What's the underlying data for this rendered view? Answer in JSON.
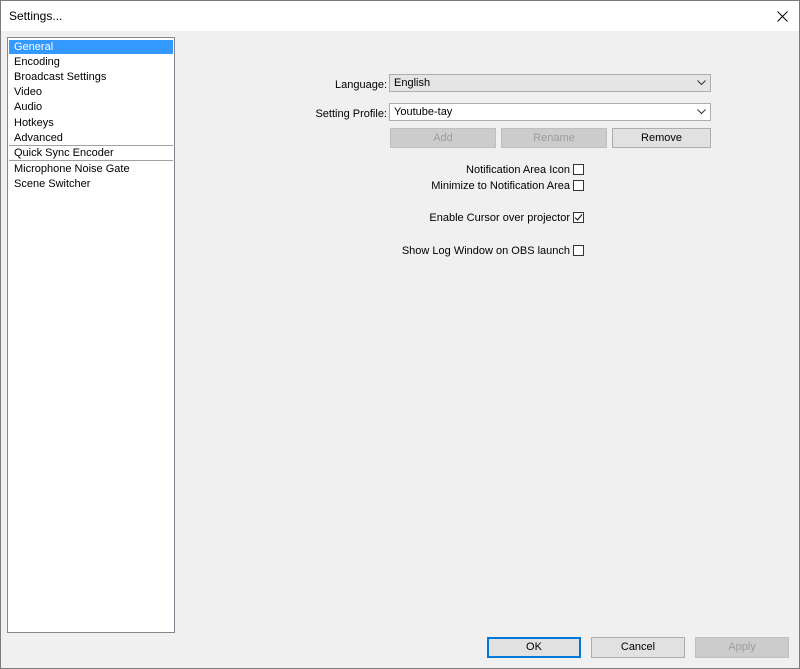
{
  "window": {
    "title": "Settings..."
  },
  "sidebar": {
    "group1": [
      "General",
      "Encoding",
      "Broadcast Settings",
      "Video",
      "Audio",
      "Hotkeys",
      "Advanced"
    ],
    "group2": [
      "Quick Sync Encoder"
    ],
    "group3": [
      "Microphone Noise Gate",
      "Scene Switcher"
    ],
    "selected": "General"
  },
  "general": {
    "language_label": "Language:",
    "language_value": "English",
    "profile_label": "Setting Profile:",
    "profile_value": "Youtube-tay",
    "add_label": "Add",
    "rename_label": "Rename",
    "remove_label": "Remove",
    "notif_icon_label": "Notification Area Icon",
    "notif_icon_checked": false,
    "minimize_label": "Minimize to Notification Area",
    "minimize_checked": false,
    "cursor_label": "Enable Cursor over projector",
    "cursor_checked": true,
    "log_label": "Show Log Window on OBS launch",
    "log_checked": false
  },
  "footer": {
    "ok_label": "OK",
    "cancel_label": "Cancel",
    "apply_label": "Apply"
  },
  "colors": {
    "selection": "#3399ff",
    "primary_border": "#0078d7"
  }
}
